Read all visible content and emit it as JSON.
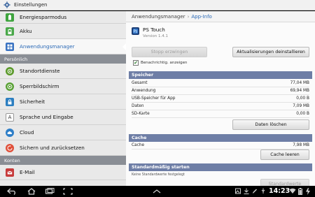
{
  "titlebar": {
    "title": "Einstellungen",
    "icon": "gear-icon"
  },
  "sidebar": {
    "items_top": [
      {
        "label": "Energiesparmodus",
        "icon": "battery-icon",
        "color": "#3fa43f"
      },
      {
        "label": "Akku",
        "icon": "battery-icon",
        "color": "#4aa84a"
      },
      {
        "label": "Anwendungsmanager",
        "icon": "apps-grid-icon",
        "color": "#3a73c2",
        "active": true
      }
    ],
    "section_personal": "Persönlich",
    "items_personal": [
      {
        "label": "Standortdienste",
        "icon": "location-icon",
        "color": "#5c9a2c"
      },
      {
        "label": "Sperrbildschirm",
        "icon": "lock-screen-icon",
        "color": "#58a034"
      },
      {
        "label": "Sicherheit",
        "icon": "lock-icon",
        "color": "#2d7fc1"
      },
      {
        "label": "Sprache und Eingabe",
        "icon": "keyboard-icon",
        "color": "#777777"
      },
      {
        "label": "Cloud",
        "icon": "cloud-icon",
        "color": "#2f7fc8"
      },
      {
        "label": "Sichern und zurücksetzen",
        "icon": "backup-icon",
        "color": "#e0503a"
      }
    ],
    "section_accounts": "Konten",
    "items_accounts": [
      {
        "label": "E-Mail",
        "icon": "email-icon",
        "color": "#c73b3b"
      }
    ]
  },
  "content": {
    "breadcrumb": {
      "parent": "Anwendungsmanager",
      "current": "App-Info"
    },
    "app": {
      "name": "PS Touch",
      "version": "Version 1.4.1"
    },
    "buttons": {
      "force_stop": "Stopp erzwingen",
      "uninstall_updates": "Aktualisierungen deinstallieren",
      "clear_data": "Daten löschen",
      "clear_cache": "Cache leeren",
      "defaults": "Standardwerte"
    },
    "notify_checkbox": {
      "label": "Benachrichtig. anzeigen",
      "checked": true
    },
    "storage": {
      "header": "Speicher",
      "rows": [
        {
          "label": "Gesamt",
          "value": "77,04 MB"
        },
        {
          "label": "Anwendung",
          "value": "69,94 MB"
        },
        {
          "label": "USB-Speicher für App",
          "value": "0,00 B"
        },
        {
          "label": "Daten",
          "value": "7,09 MB"
        },
        {
          "label": "SD-Karte",
          "value": "0,00 B"
        }
      ]
    },
    "cache": {
      "header": "Cache",
      "rows": [
        {
          "label": "Cache",
          "value": "7,98 MB"
        }
      ]
    },
    "defaults": {
      "header": "Standardmäßig starten",
      "note": "Keine Standardwerte festgelegt"
    }
  },
  "statusbar": {
    "time": "14:23"
  }
}
